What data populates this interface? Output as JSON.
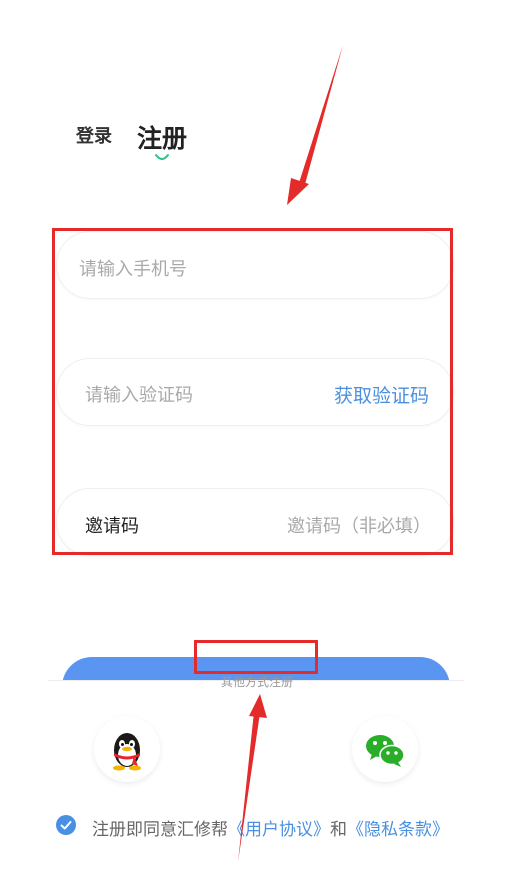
{
  "tabs": {
    "login": "登录",
    "register": "注册"
  },
  "form": {
    "phone_placeholder": "请输入手机号",
    "code_placeholder": "请输入验证码",
    "get_code": "获取验证码",
    "invite_label": "邀请码",
    "invite_placeholder": "邀请码（非必填）"
  },
  "other_methods": "其他方式注册",
  "social": [
    "qq-icon",
    "wechat-icon"
  ],
  "agreement": {
    "prefix": "注册即同意汇修帮",
    "user_agreement": "《用户协议》",
    "and": "和",
    "privacy": "《隐私条款》",
    "checked": true
  },
  "colors": {
    "accent": "#4a90e2",
    "button": "#5b95f2",
    "annotation": "#e52a2a",
    "tab_indicator": "#2cc486"
  }
}
